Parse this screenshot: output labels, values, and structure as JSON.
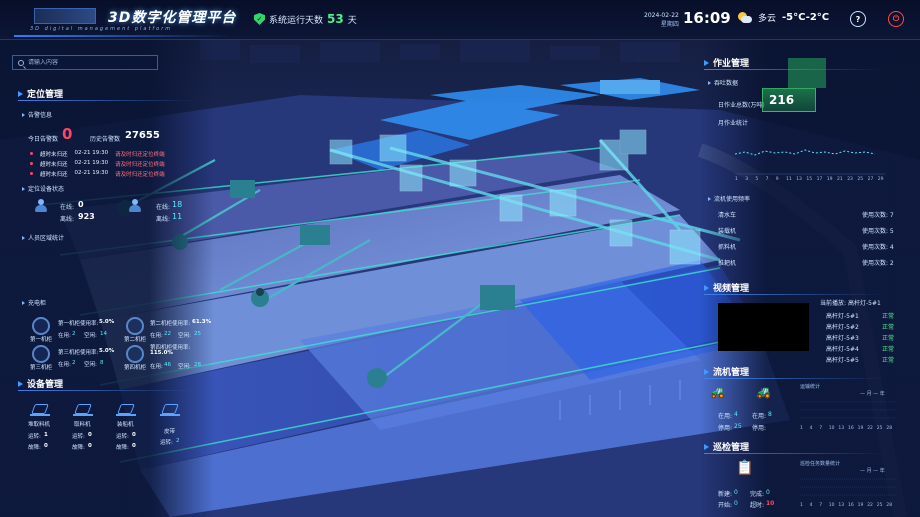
{
  "header": {
    "title": "3D数字化管理平台",
    "subtitle": "3D  digital  management  platform",
    "runtime_label": "系统运行天数",
    "runtime_days": "53",
    "runtime_unit": "天",
    "date": "2024-02-22",
    "weekday": "星期四",
    "time": "16:09",
    "weather": "多云",
    "temperature": "-5°C-2°C",
    "help_label": "?",
    "power_label": "⏻"
  },
  "search": {
    "placeholder": "请输入内容"
  },
  "left": {
    "positioning": {
      "title": "定位管理",
      "alarm_info": {
        "title": "告警信息",
        "today_label": "今日告警数",
        "today_value": "0",
        "history_label": "历史告警数",
        "history_value": "27655",
        "rows": [
          {
            "type": "超时未归还",
            "time": "02-21 19:30",
            "status": "请及时归还定位终端"
          },
          {
            "type": "超时未归还",
            "time": "02-21 19:30",
            "status": "请及时归还定位终端"
          },
          {
            "type": "超时未归还",
            "time": "02-21 19:30",
            "status": "请及时归还定位终端"
          }
        ]
      },
      "device_status": {
        "title": "定位设备状态",
        "online_label": "在线:",
        "online_a": "0",
        "offline_label": "离线:",
        "offline_a": "923",
        "online_b": "18",
        "offline_b": "11"
      },
      "area_stats": {
        "title": "人员区域统计"
      }
    },
    "charging": {
      "title": "充电柜",
      "cabinets": [
        {
          "name": "第一机柜",
          "rate_label": "第一机柜使用率:",
          "rate": "5.0%",
          "online": "2",
          "free": "14"
        },
        {
          "name": "第二机柜",
          "rate_label": "第二机柜使用率:",
          "rate": "61.3%",
          "online": "22",
          "free": "25"
        },
        {
          "name": "第三机柜",
          "rate_label": "第三机柜使用率:",
          "rate": "5.0%",
          "online": "2",
          "free": "8"
        },
        {
          "name": "第四机柜",
          "rate_label": "第四机柜使用率:",
          "rate": "115.0%",
          "online": "46",
          "free": "28"
        }
      ],
      "online_label": "在用:",
      "free_label": "空闲:"
    },
    "equipment": {
      "title": "设备管理",
      "items": [
        {
          "name": "堆取料机",
          "run": "1",
          "fault": "0"
        },
        {
          "name": "取料机",
          "run": "0",
          "fault": "0"
        },
        {
          "name": "装船机",
          "run": "0",
          "fault": "0"
        },
        {
          "name": "皮带",
          "run": "2",
          "fault": "0"
        }
      ],
      "run_label": "运转:",
      "fault_label": "故障:"
    }
  },
  "right": {
    "operation": {
      "title": "作业管理",
      "throughput_title": "吞吐数据",
      "daily_label": "日作业总数(万吨)",
      "daily_value": "216",
      "monthly_label": "月作业统计",
      "x_ticks": [
        "1",
        "3",
        "5",
        "7",
        "9",
        "11",
        "13",
        "15",
        "17",
        "19",
        "21",
        "23",
        "25",
        "27",
        "29"
      ]
    },
    "process": {
      "title": "流机使用频率",
      "items": [
        {
          "name": "清水车",
          "uses": "使用次数: 7"
        },
        {
          "name": "装载机",
          "uses": "使用次数: 5"
        },
        {
          "name": "抓料机",
          "uses": "使用次数: 4"
        },
        {
          "name": "推耙机",
          "uses": "使用次数: 2"
        }
      ]
    },
    "video": {
      "title": "视频管理",
      "current_label": "当前播放:",
      "current_value": "高杆灯-5#1",
      "list": [
        {
          "name": "高杆灯-5#1",
          "status": "正常"
        },
        {
          "name": "高杆灯-5#2",
          "status": "正常"
        },
        {
          "name": "高杆灯-5#3",
          "status": "正常"
        },
        {
          "name": "高杆灯-5#4",
          "status": "正常"
        },
        {
          "name": "高杆灯-5#5",
          "status": "正常"
        }
      ]
    },
    "flow": {
      "title": "流机管理",
      "online_label": "在用:",
      "online_value": "4",
      "total_label": "在用:",
      "total_value": "8",
      "stop_label": "停用:",
      "stop_value": "25",
      "stop2_label": "停用:",
      "chart_title": "运输统计",
      "legend": "— 月 — 年",
      "x_ticks": [
        "1",
        "4",
        "7",
        "10",
        "13",
        "16",
        "19",
        "22",
        "25",
        "28"
      ]
    },
    "inspection": {
      "title": "巡检管理",
      "new_label": "新建:",
      "new_value": "0",
      "done_label": "完成:",
      "done_value": "0",
      "open_label": "开始:",
      "open_value": "0",
      "timeout_label": "超时:",
      "timeout_value": "10",
      "chart_title": "巡检任务数量统计",
      "legend": "— 月 — 年",
      "x_ticks": [
        "1",
        "4",
        "7",
        "10",
        "13",
        "16",
        "19",
        "22",
        "25",
        "28"
      ]
    }
  }
}
